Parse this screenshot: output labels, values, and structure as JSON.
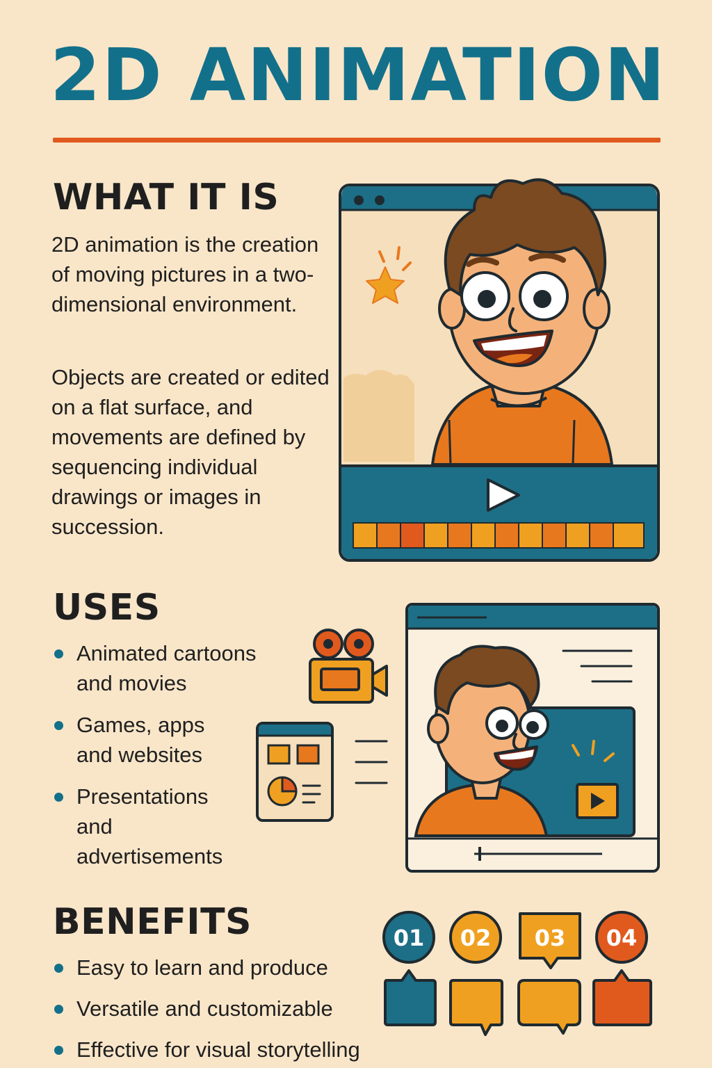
{
  "title": "2D ANIMATION",
  "sections": {
    "what": {
      "heading": "WHAT IT IS",
      "paragraph1": "2D animation is the creation of moving pictures in a two-dimensional environment.",
      "paragraph2": "Objects are created or edited on a flat surface, and movements are defined by sequencing individual drawings or images in succession."
    },
    "uses": {
      "heading": "USES",
      "items": [
        "Animated cartoons and movies",
        "Games, apps and websites",
        "Presentations and advertisements"
      ]
    },
    "benefits": {
      "heading": "BENEFITS",
      "items": [
        "Easy to learn and produce",
        "Versatile and customizable",
        "Effective for visual storytelling"
      ],
      "badges": [
        "01",
        "02",
        "03",
        "04"
      ]
    }
  },
  "colors": {
    "background": "#f9e6c9",
    "teal": "#1c6f86",
    "orange": "#e8781e",
    "amber": "#f0a020",
    "red_orange": "#e05a1e"
  },
  "icons": [
    "star-icon",
    "play-icon",
    "video-camera-icon",
    "presentation-icon",
    "pie-chart-icon"
  ]
}
